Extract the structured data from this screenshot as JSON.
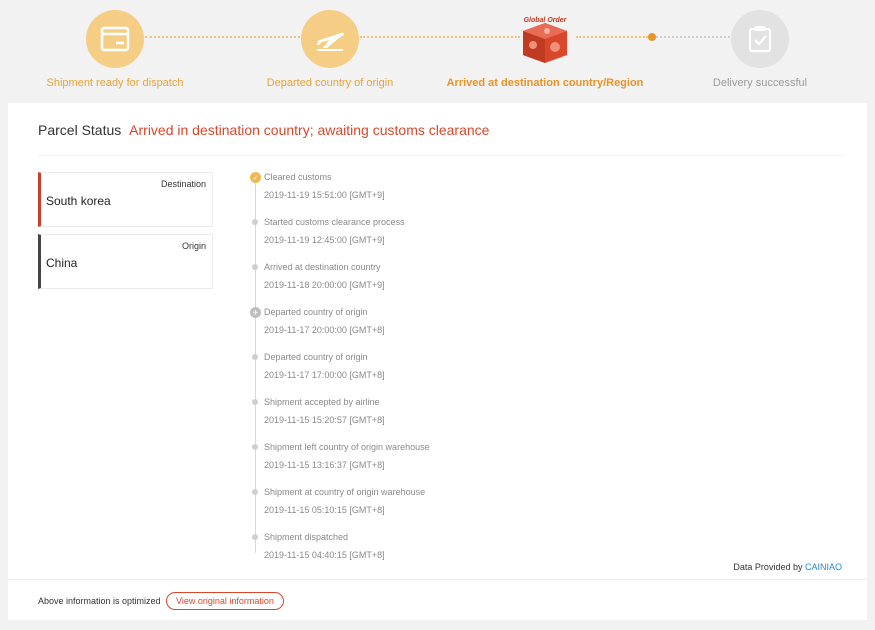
{
  "steps": [
    {
      "label": "Shipment ready for dispatch",
      "icon": "parcel-icon",
      "state": "done"
    },
    {
      "label": "Departed country of origin",
      "icon": "plane-departure-icon",
      "state": "done"
    },
    {
      "label": "Arrived at destination country/Region",
      "icon": "global-order-box-icon",
      "state": "current",
      "image_text": "Global Order"
    },
    {
      "label": "Delivery successful",
      "icon": "clipboard-check-icon",
      "state": "pending"
    }
  ],
  "status": {
    "prefix": "Parcel Status",
    "value": "Arrived in destination country; awaiting customs clearance"
  },
  "places": {
    "destination": {
      "tag": "Destination",
      "name": "South korea",
      "color": "#c8402a"
    },
    "origin": {
      "tag": "Origin",
      "name": "China",
      "color": "#444444"
    }
  },
  "events": [
    {
      "title": "Cleared customs",
      "time": "2019-11-19 15:51:00 [GMT+9]",
      "marker": "customs-icon"
    },
    {
      "title": "Started customs clearance process",
      "time": "2019-11-19 12:45:00 [GMT+9]",
      "marker": "dot"
    },
    {
      "title": "Arrived at destination country",
      "time": "2019-11-18 20:00:00 [GMT+9]",
      "marker": "dot"
    },
    {
      "title": "Departed country of origin",
      "time": "2019-11-17 20:00:00 [GMT+8]",
      "marker": "plane-icon"
    },
    {
      "title": "Departed country of origin",
      "time": "2019-11-17 17:00:00 [GMT+8]",
      "marker": "dot"
    },
    {
      "title": "Shipment accepted by airline",
      "time": "2019-11-15 15:20:57 [GMT+8]",
      "marker": "dot"
    },
    {
      "title": "Shipment left country of origin warehouse",
      "time": "2019-11-15 13:16:37 [GMT+8]",
      "marker": "dot"
    },
    {
      "title": "Shipment at country of origin warehouse",
      "time": "2019-11-15 05:10:15 [GMT+8]",
      "marker": "dot"
    },
    {
      "title": "Shipment dispatched",
      "time": "2019-11-15 04:40:15 [GMT+8]",
      "marker": "dot"
    }
  ],
  "provided": {
    "prefix": "Data Provided by",
    "brand": "CAINIAO"
  },
  "footer": {
    "note": "Above information is optimized",
    "button": "View original information"
  },
  "colors": {
    "accent": "#e79428",
    "status": "#d9472b",
    "brand_link": "#2c86c9"
  }
}
